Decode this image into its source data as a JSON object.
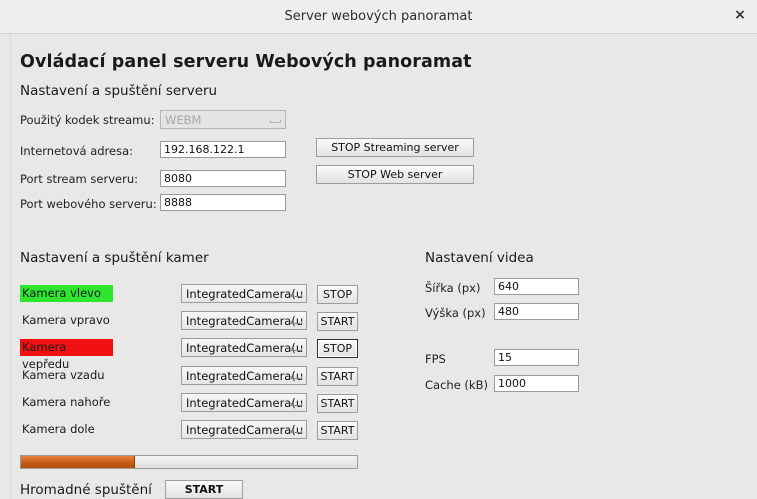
{
  "window": {
    "title": "Server webových panoramat",
    "close_glyph": "×"
  },
  "heading": "Ovládací panel serveru Webových panoramat",
  "server": {
    "section_title": "Nastavení a spuštění serveru",
    "codec_label": "Použitý kodek streamu:",
    "codec_value": "WEBM",
    "address_label": "Internetová adresa:",
    "address_value": "192.168.122.1",
    "stream_port_label": "Port stream serveru:",
    "stream_port_value": "8080",
    "web_port_label": "Port webového serveru:",
    "web_port_value": "8888",
    "stop_streaming_label": "STOP Streaming server",
    "stop_web_label": "STOP Web server"
  },
  "cameras": {
    "section_title": "Nastavení a spuštění kamer",
    "items": [
      {
        "label": "Kamera vlevo",
        "device": "IntegratedCamera(u",
        "action": "STOP",
        "highlight": "#2ee62e"
      },
      {
        "label": "Kamera vpravo",
        "device": "IntegratedCamera(u",
        "action": "START",
        "highlight": ""
      },
      {
        "label": "Kamera vepředu",
        "device": "IntegratedCamera(u",
        "action": "STOP",
        "highlight": "#f01010"
      },
      {
        "label": "Kamera vzadu",
        "device": "IntegratedCamera(u",
        "action": "START",
        "highlight": ""
      },
      {
        "label": "Kamera nahoře",
        "device": "IntegratedCamera(u",
        "action": "START",
        "highlight": ""
      },
      {
        "label": "Kamera dole",
        "device": "IntegratedCamera(u",
        "action": "START",
        "highlight": ""
      }
    ]
  },
  "video": {
    "section_title": "Nastavení videa",
    "width_label": "Šířka (px)",
    "width_value": "640",
    "height_label": "Výška (px)",
    "height_value": "480",
    "fps_label": "FPS",
    "fps_value": "15",
    "cache_label": "Cache (kB)",
    "cache_value": "1000"
  },
  "bulk": {
    "label": "Hromadné spuštění",
    "button_label": "START",
    "progress_fraction": 0.34
  }
}
